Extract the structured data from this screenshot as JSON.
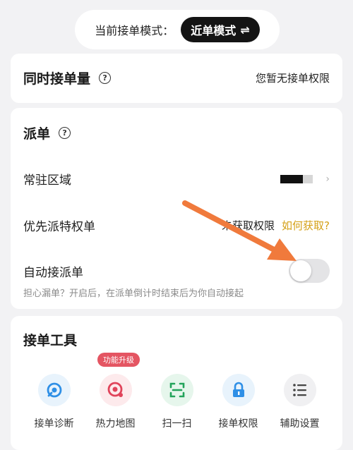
{
  "mode": {
    "label": "当前接单模式：",
    "value": "近单模式",
    "swap_glyph": "⇌"
  },
  "volume": {
    "title": "同时接单量",
    "status": "您暂无接单权限"
  },
  "dispatch": {
    "title": "派单",
    "area_label": "常驻区域",
    "priv_label": "优先派特权单",
    "priv_status": "未获取权限",
    "priv_link": "如何获取?",
    "auto_label": "自动接派单",
    "auto_enabled": false,
    "hint": "担心漏单？开启后，在派单倒计时结束后为你自动接起"
  },
  "tools": {
    "title": "接单工具",
    "upgrade_badge": "功能升级",
    "items": [
      {
        "label": "接单诊断",
        "icon": "diagnosis-icon"
      },
      {
        "label": "热力地图",
        "icon": "heatmap-icon"
      },
      {
        "label": "扫一扫",
        "icon": "scan-icon"
      },
      {
        "label": "接单权限",
        "icon": "lock-icon"
      },
      {
        "label": "辅助设置",
        "icon": "list-icon"
      }
    ]
  },
  "colors": {
    "accent_gold": "#d4a017",
    "badge_red": "#e45562",
    "arrow_orange": "#f07a3c"
  }
}
